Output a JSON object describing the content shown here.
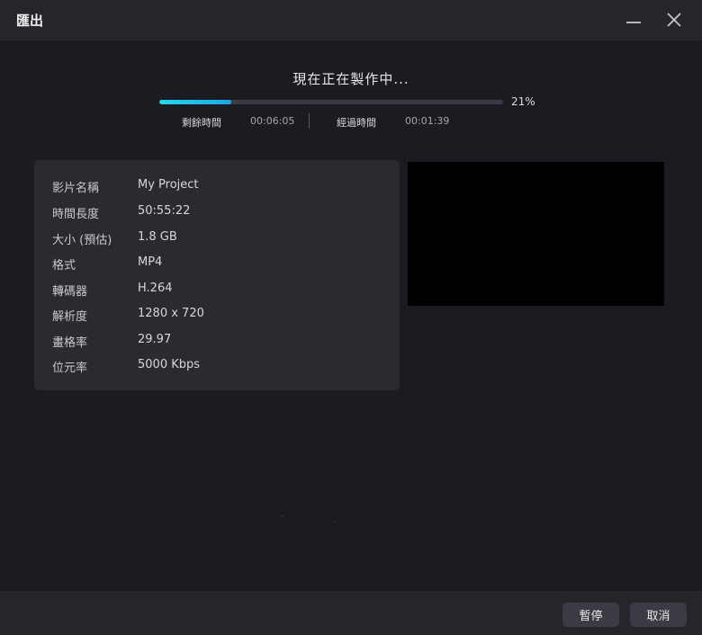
{
  "window": {
    "title": "匯出",
    "minimize_icon": "minimize-icon",
    "close_icon": "close-icon"
  },
  "status": {
    "title": "現在正在製作中...",
    "progress_percent": 21,
    "progress_label": "21%",
    "remaining_label": "剩餘時間",
    "remaining_value": "00:06:05",
    "elapsed_label": "經過時間",
    "elapsed_value": "00:01:39"
  },
  "info": {
    "rows": [
      {
        "key": "影片名稱",
        "value": "My Project"
      },
      {
        "key": "時間長度",
        "value": "50:55:22"
      },
      {
        "key": "大小 (預估)",
        "value": "1.8 GB"
      },
      {
        "key": "格式",
        "value": "MP4"
      },
      {
        "key": "轉碼器",
        "value": "H.264"
      },
      {
        "key": "解析度",
        "value": "1280 x 720"
      },
      {
        "key": "畫格率",
        "value": "29.97"
      },
      {
        "key": "位元率",
        "value": "5000 Kbps"
      }
    ]
  },
  "footer": {
    "pause_label": "暫停",
    "cancel_label": "取消"
  },
  "colors": {
    "background": "#1b1c21",
    "titlebar": "#25262c",
    "panel": "#2a2b31",
    "progress_accent": "#20d8ec",
    "button": "#3b3c43"
  }
}
